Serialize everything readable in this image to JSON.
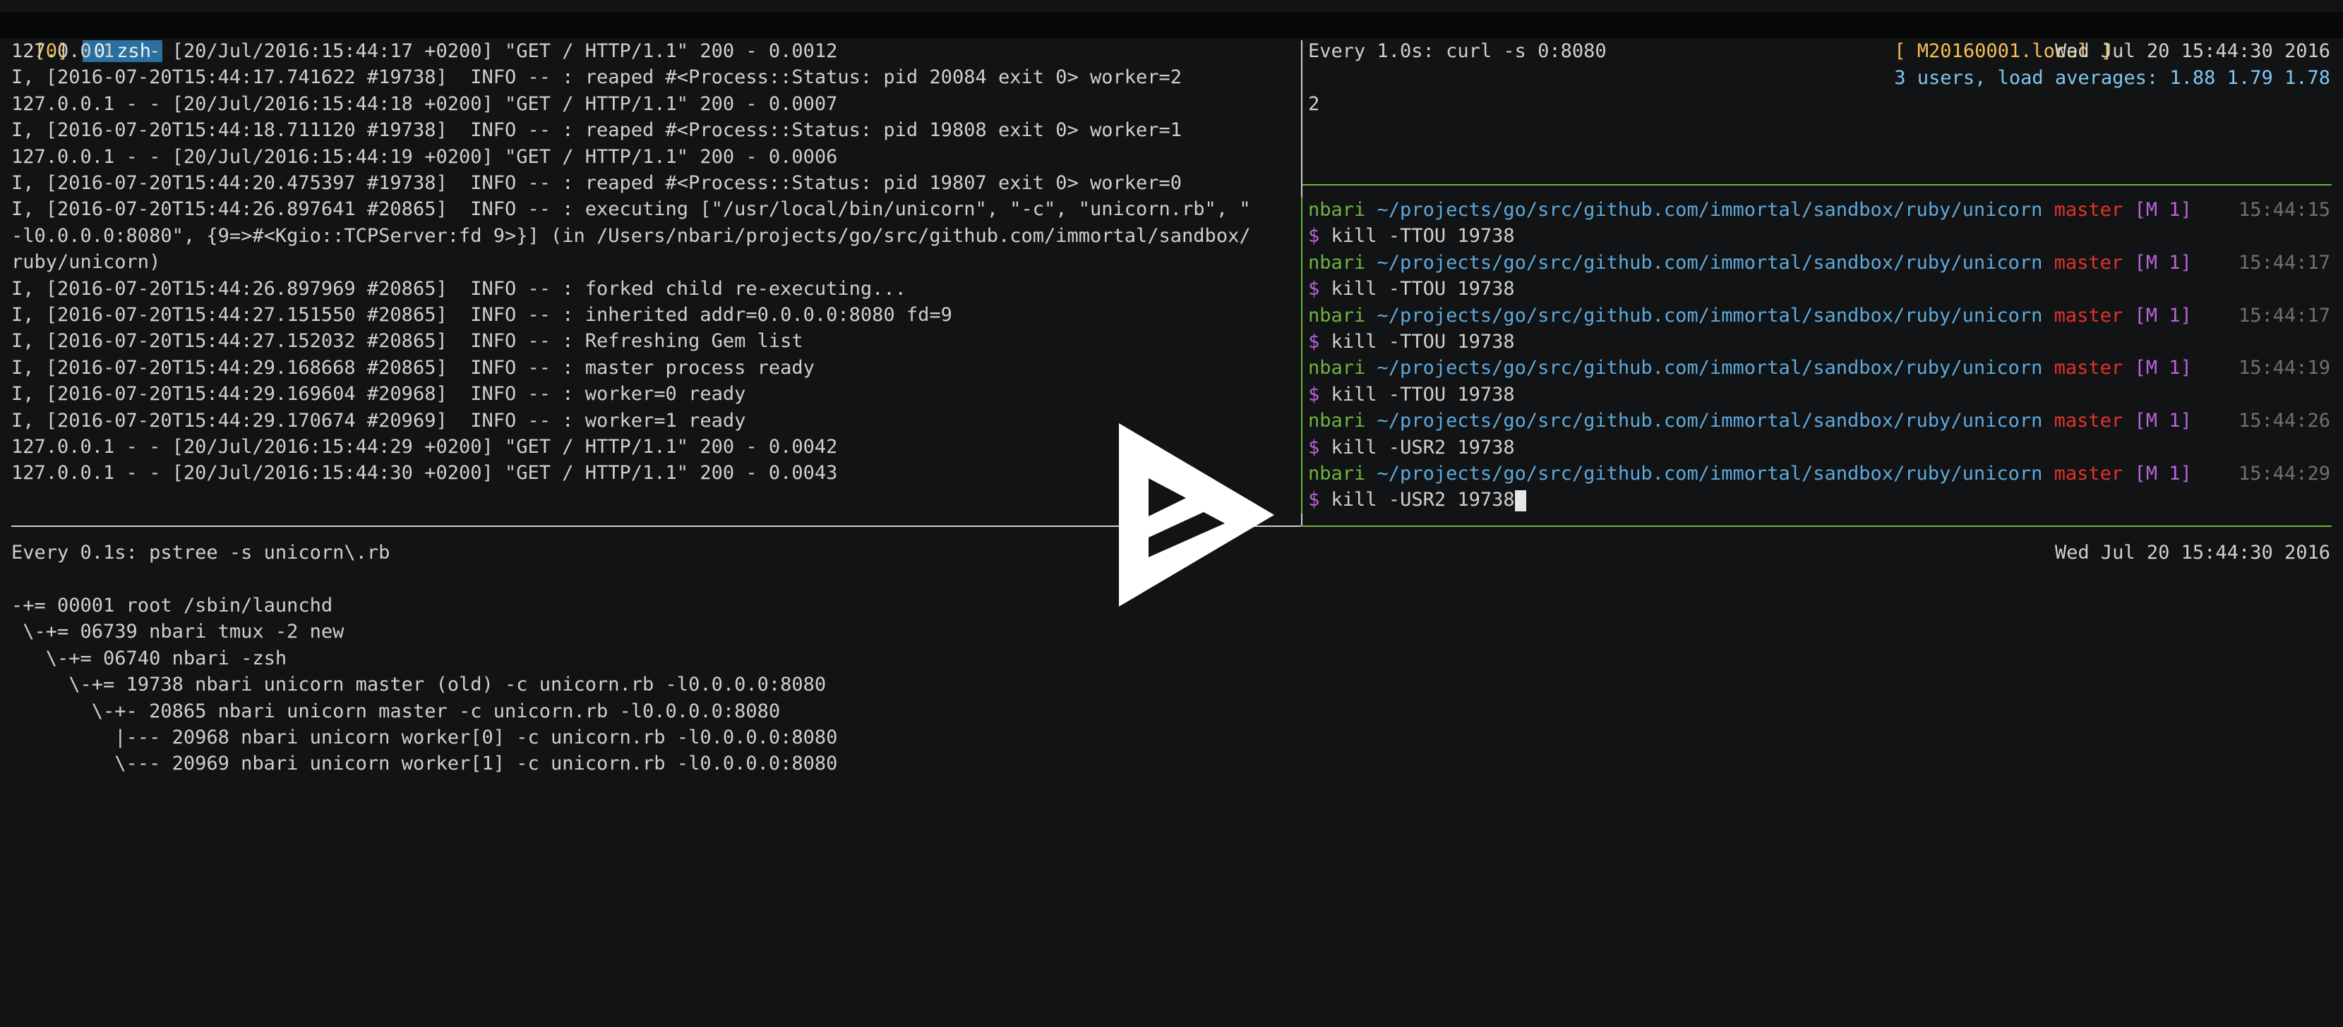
{
  "status_bar": {
    "window_index": "[0]",
    "active_window": " 0 zsh ",
    "host": "[ M20160001.local ]",
    "load": "3 users, load averages: 1.88 1.79 1.78"
  },
  "left_pane_lines": [
    "127.0.0.1 - - [20/Jul/2016:15:44:17 +0200] \"GET / HTTP/1.1\" 200 - 0.0012",
    "I, [2016-07-20T15:44:17.741622 #19738]  INFO -- : reaped #<Process::Status: pid 20084 exit 0> worker=2",
    "127.0.0.1 - - [20/Jul/2016:15:44:18 +0200] \"GET / HTTP/1.1\" 200 - 0.0007",
    "I, [2016-07-20T15:44:18.711120 #19738]  INFO -- : reaped #<Process::Status: pid 19808 exit 0> worker=1",
    "127.0.0.1 - - [20/Jul/2016:15:44:19 +0200] \"GET / HTTP/1.1\" 200 - 0.0006",
    "I, [2016-07-20T15:44:20.475397 #19738]  INFO -- : reaped #<Process::Status: pid 19807 exit 0> worker=0",
    "I, [2016-07-20T15:44:26.897641 #20865]  INFO -- : executing [\"/usr/local/bin/unicorn\", \"-c\", \"unicorn.rb\", \"",
    "-l0.0.0.0:8080\", {9=>#<Kgio::TCPServer:fd 9>}] (in /Users/nbari/projects/go/src/github.com/immortal/sandbox/",
    "ruby/unicorn)",
    "I, [2016-07-20T15:44:26.897969 #20865]  INFO -- : forked child re-executing...",
    "I, [2016-07-20T15:44:27.151550 #20865]  INFO -- : inherited addr=0.0.0.0:8080 fd=9",
    "I, [2016-07-20T15:44:27.152032 #20865]  INFO -- : Refreshing Gem list",
    "I, [2016-07-20T15:44:29.168668 #20865]  INFO -- : master process ready",
    "I, [2016-07-20T15:44:29.169604 #20968]  INFO -- : worker=0 ready",
    "I, [2016-07-20T15:44:29.170674 #20969]  INFO -- : worker=1 ready",
    "127.0.0.1 - - [20/Jul/2016:15:44:29 +0200] \"GET / HTTP/1.1\" 200 - 0.0042",
    "127.0.0.1 - - [20/Jul/2016:15:44:30 +0200] \"GET / HTTP/1.1\" 200 - 0.0043"
  ],
  "watch_curl": {
    "header": "Every 1.0s: curl -s 0:8080",
    "timestamp": "Wed Jul 20 15:44:30 2016",
    "output": "2"
  },
  "prompt_common": {
    "user": "nbari",
    "path": "~/projects/go/src/github.com/immortal/sandbox/ruby/unicorn",
    "branch": "master",
    "git_status": "[M 1]",
    "symbol": "$"
  },
  "shell_history": [
    {
      "time": "15:44:15",
      "command": "kill -TTOU 19738"
    },
    {
      "time": "15:44:17",
      "command": "kill -TTOU 19738"
    },
    {
      "time": "15:44:17",
      "command": "kill -TTOU 19738"
    },
    {
      "time": "15:44:19",
      "command": "kill -TTOU 19738"
    },
    {
      "time": "15:44:26",
      "command": "kill -USR2 19738"
    },
    {
      "time": "15:44:29",
      "command": "kill -USR2 19738"
    }
  ],
  "watch_pstree": {
    "header": "Every 0.1s: pstree -s unicorn\\.rb",
    "timestamp": "Wed Jul 20 15:44:30 2016",
    "lines": [
      "-+= 00001 root /sbin/launchd",
      " \\-+= 06739 nbari tmux -2 new",
      "   \\-+= 06740 nbari -zsh",
      "     \\-+= 19738 nbari unicorn master (old) -c unicorn.rb -l0.0.0.0:8080",
      "       \\-+- 20865 nbari unicorn master -c unicorn.rb -l0.0.0.0:8080",
      "         |--- 20968 nbari unicorn worker[0] -c unicorn.rb -l0.0.0.0:8080",
      "         \\--- 20969 nbari unicorn worker[1] -c unicorn.rb -l0.0.0.0:8080"
    ]
  },
  "colors": {
    "background": "#121314",
    "status_bar_bg": "#080808",
    "active_window_bg": "#2b6fa0",
    "prompt_user": "#6fb43f",
    "prompt_path": "#5ea9dd",
    "prompt_branch": "#e0332e",
    "prompt_git": "#b864d8",
    "active_pane_border": "#6fb43f"
  },
  "overlay": {
    "icon": "play-icon"
  }
}
